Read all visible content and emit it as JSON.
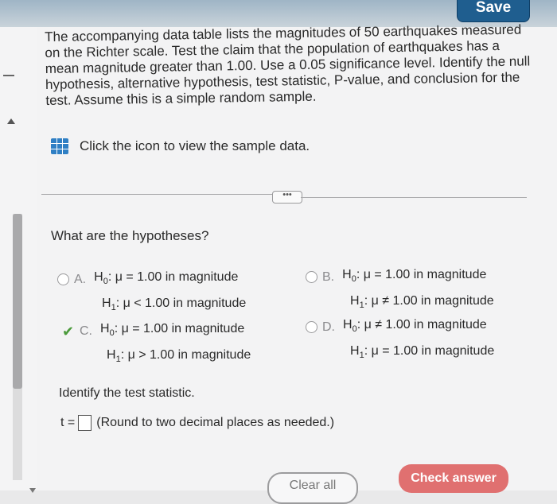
{
  "header": {
    "save_label": "Save"
  },
  "problem": {
    "text": "The accompanying data table lists the magnitudes of 50 earthquakes measured on the Richter scale. Test the claim that the population of earthquakes has a mean magnitude greater than 1.00. Use a 0.05 significance level. Identify the null hypothesis, alternative hypothesis, test statistic, P-value, and conclusion for the test. Assume this is a simple random sample."
  },
  "data_link": {
    "label": "Click the icon to view the sample data.",
    "icon": "table-grid-icon"
  },
  "divider": {
    "more_label": "•••"
  },
  "question": "What are the hypotheses?",
  "choices": [
    {
      "letter": "A.",
      "h0": "H",
      "h0_sub": "0",
      "h0_rest": ": μ = 1.00 in magnitude",
      "h1": "H",
      "h1_sub": "1",
      "h1_rest": ": μ < 1.00 in magnitude",
      "selected": false
    },
    {
      "letter": "B.",
      "h0": "H",
      "h0_sub": "0",
      "h0_rest": ": μ = 1.00 in magnitude",
      "h1": "H",
      "h1_sub": "1",
      "h1_rest": ": μ ≠ 1.00 in magnitude",
      "selected": false
    },
    {
      "letter": "C.",
      "h0": "H",
      "h0_sub": "0",
      "h0_rest": ": μ = 1.00 in magnitude",
      "h1": "H",
      "h1_sub": "1",
      "h1_rest": ": μ > 1.00 in magnitude",
      "selected": true
    },
    {
      "letter": "D.",
      "h0": "H",
      "h0_sub": "0",
      "h0_rest": ": μ ≠ 1.00 in magnitude",
      "h1": "H",
      "h1_sub": "1",
      "h1_rest": ": μ = 1.00 in magnitude",
      "selected": false
    }
  ],
  "test_statistic": {
    "prompt": "Identify the test statistic.",
    "var_label": "t =",
    "hint": "(Round to two decimal places as needed.)"
  },
  "buttons": {
    "clear_all": "Clear all",
    "check_answer": "Check answer"
  },
  "colors": {
    "accent": "#1f5e8f",
    "check_button": "#e07070",
    "correct": "#4a9a3a",
    "table_icon": "#2f7fc4"
  }
}
